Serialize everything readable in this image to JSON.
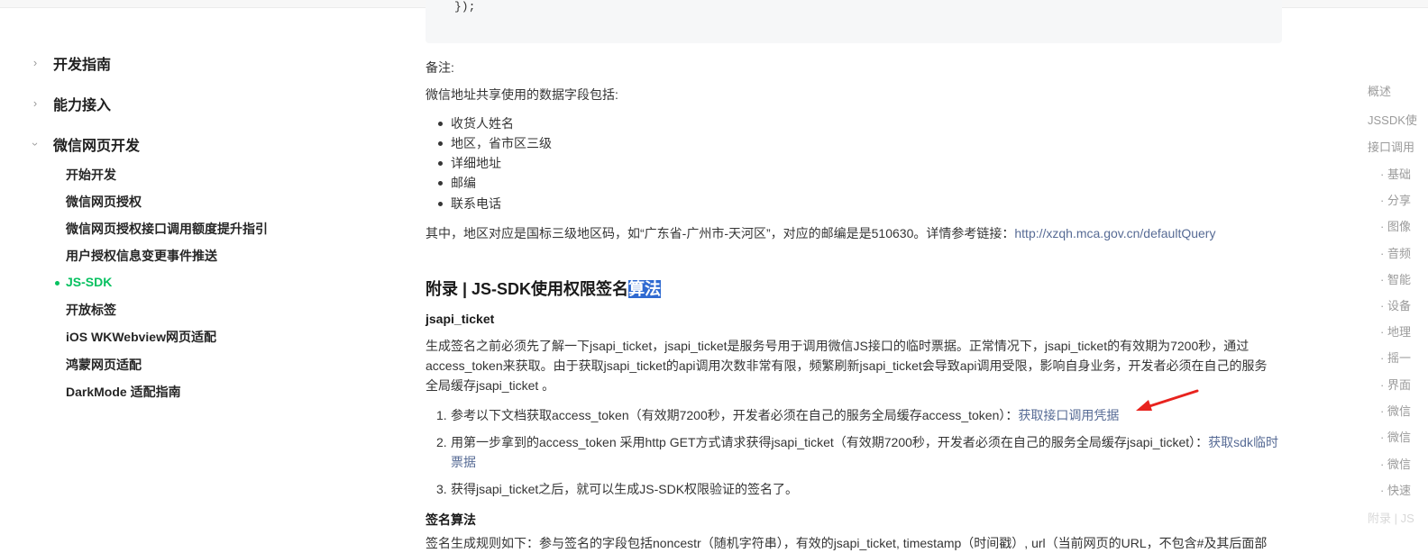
{
  "sidebar": {
    "sections": [
      {
        "label": "开发指南",
        "expanded": false
      },
      {
        "label": "能力接入",
        "expanded": false
      },
      {
        "label": "微信网页开发",
        "expanded": true
      }
    ],
    "items": [
      {
        "label": "开始开发"
      },
      {
        "label": "微信网页授权"
      },
      {
        "label": "微信网页授权接口调用额度提升指引"
      },
      {
        "label": "用户授权信息变更事件推送"
      },
      {
        "label": "JS-SDK",
        "active": true
      },
      {
        "label": "开放标签"
      },
      {
        "label": "iOS WKWebview网页适配"
      },
      {
        "label": "鸿蒙网页适配"
      },
      {
        "label": "DarkMode 适配指南"
      }
    ]
  },
  "content": {
    "code_tail": "});",
    "note_label": "备注:",
    "fields_intro": "微信地址共享使用的数据字段包括:",
    "fields": [
      "收货人姓名",
      "地区，省市区三级",
      "详细地址",
      "邮编",
      "联系电话"
    ],
    "region_text": "其中，地区对应是国标三级地区码，如“广东省-广州市-天河区”，对应的邮编是是510630。详情参考链接：",
    "region_link": "http://xzqh.mca.gov.cn/defaultQuery",
    "heading_prefix": "附录 | JS-SDK使用权限签名",
    "heading_highlight": "算法",
    "jsapi_heading": "jsapi_ticket",
    "jsapi_paragraph": "生成签名之前必须先了解一下jsapi_ticket，jsapi_ticket是服务号用于调用微信JS接口的临时票据。正常情况下，jsapi_ticket的有效期为7200秒，通过access_token来获取。由于获取jsapi_ticket的api调用次数非常有限，频繁刷新jsapi_ticket会导致api调用受限，影响自身业务，开发者必须在自己的服务全局缓存jsapi_ticket 。",
    "steps": [
      {
        "num": "1.",
        "text": "参考以下文档获取access_token（有效期7200秒，开发者必须在自己的服务全局缓存access_token）：",
        "link": "获取接口调用凭据"
      },
      {
        "num": "2.",
        "text": "用第一步拿到的access_token 采用http GET方式请求获得jsapi_ticket（有效期7200秒，开发者必须在自己的服务全局缓存jsapi_ticket）：",
        "link": "获取sdk临时票据"
      },
      {
        "num": "3.",
        "text": "获得jsapi_ticket之后，就可以生成JS-SDK权限验证的签名了。",
        "link": ""
      }
    ],
    "sign_heading": "签名算法",
    "sign_paragraph_partial": "签名生成规则如下：参与签名的字段包括noncestr（随机字符串），有效的jsapi_ticket, timestamp（时间戳）, url（当前网页的URL，不包含#及其后面部"
  },
  "toc": {
    "items": [
      {
        "label": "概述",
        "level": 1
      },
      {
        "label": "JSSDK使",
        "level": 1
      },
      {
        "label": "接口调用",
        "level": 1
      },
      {
        "label": "· 基础",
        "level": 2
      },
      {
        "label": "· 分享",
        "level": 2
      },
      {
        "label": "· 图像",
        "level": 2
      },
      {
        "label": "· 音频",
        "level": 2
      },
      {
        "label": "· 智能",
        "level": 2
      },
      {
        "label": "· 设备",
        "level": 2
      },
      {
        "label": "· 地理",
        "level": 2
      },
      {
        "label": "· 摇一",
        "level": 2
      },
      {
        "label": "· 界面",
        "level": 2
      },
      {
        "label": "· 微信",
        "level": 2
      },
      {
        "label": "· 微信",
        "level": 2
      },
      {
        "label": "· 微信",
        "level": 2
      },
      {
        "label": "· 快速",
        "level": 2
      },
      {
        "label": "附录 | JS",
        "level": 1
      }
    ]
  },
  "colors": {
    "accent_green": "#07c160",
    "link_blue": "#576b95",
    "highlight_blue": "#2f6ad1",
    "annotation_arrow": "#e8231e"
  }
}
